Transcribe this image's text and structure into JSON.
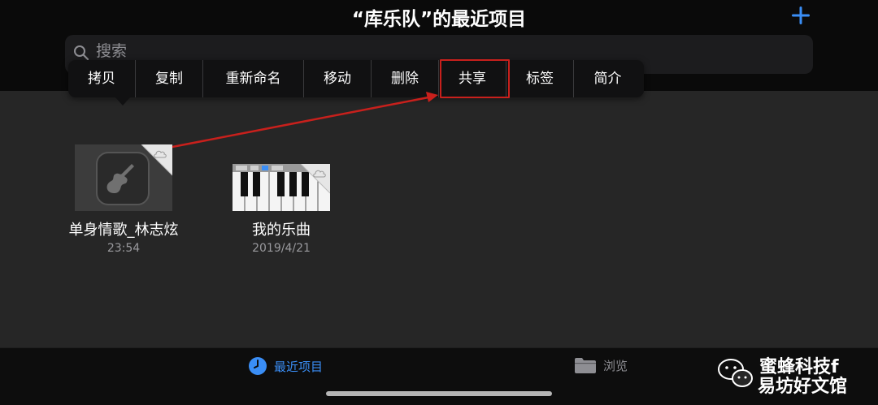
{
  "header": {
    "title": "“库乐队”的最近项目",
    "add_icon": "plus-icon",
    "accent_color": "#3a8ef6"
  },
  "search": {
    "placeholder": "搜索",
    "icon": "magnifier-icon"
  },
  "context_menu": {
    "items": [
      {
        "label": "拷贝"
      },
      {
        "label": "复制"
      },
      {
        "label": "重新命名"
      },
      {
        "label": "移动"
      },
      {
        "label": "删除"
      },
      {
        "label": "共享",
        "highlighted": true
      },
      {
        "label": "标签"
      },
      {
        "label": "简介"
      }
    ],
    "highlight_color": "#c8201c"
  },
  "files": [
    {
      "name": "单身情歌_林志炫",
      "meta": "23:54",
      "thumb_icon": "garageband-guitar-icon",
      "badge_icon": "cloud-icon"
    },
    {
      "name": "我的乐曲",
      "meta": "2019/4/21",
      "thumb_icon": "piano-keyboard-icon",
      "badge_icon": "cloud-icon"
    }
  ],
  "tabbar": {
    "tabs": [
      {
        "label": "最近项目",
        "icon": "clock-icon",
        "active": true
      },
      {
        "label": "浏览",
        "icon": "folder-icon",
        "active": false
      }
    ]
  },
  "watermark": {
    "line1": "蜜蜂科技f",
    "line2": "易坊好文馆",
    "icon": "wechat-icon"
  }
}
